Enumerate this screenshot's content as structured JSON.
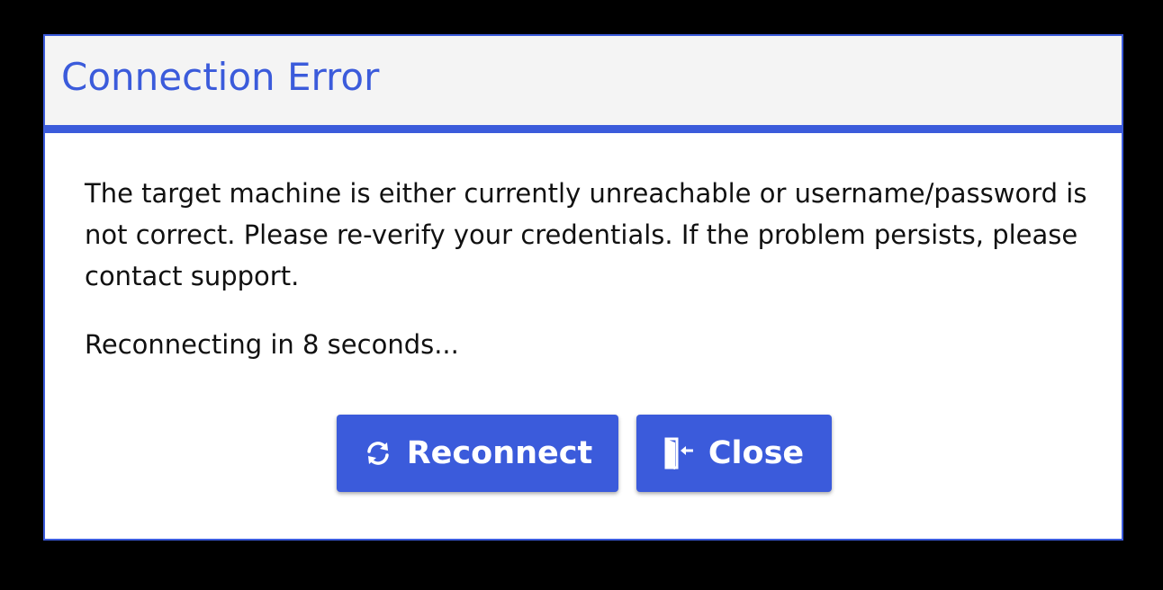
{
  "dialog": {
    "title": "Connection Error",
    "message": "The target machine is either currently unreachable or username/password is not correct. Please re-verify your credentials. If the problem persists, please contact support.",
    "status": "Reconnecting in 8 seconds...",
    "buttons": {
      "reconnect_label": "Reconnect",
      "reconnect_icon": "refresh-icon",
      "close_label": "Close",
      "close_icon": "exit-door-icon"
    }
  },
  "colors": {
    "accent": "#3b5bdb",
    "header_bg": "#f4f4f4",
    "backdrop": "#000000"
  }
}
